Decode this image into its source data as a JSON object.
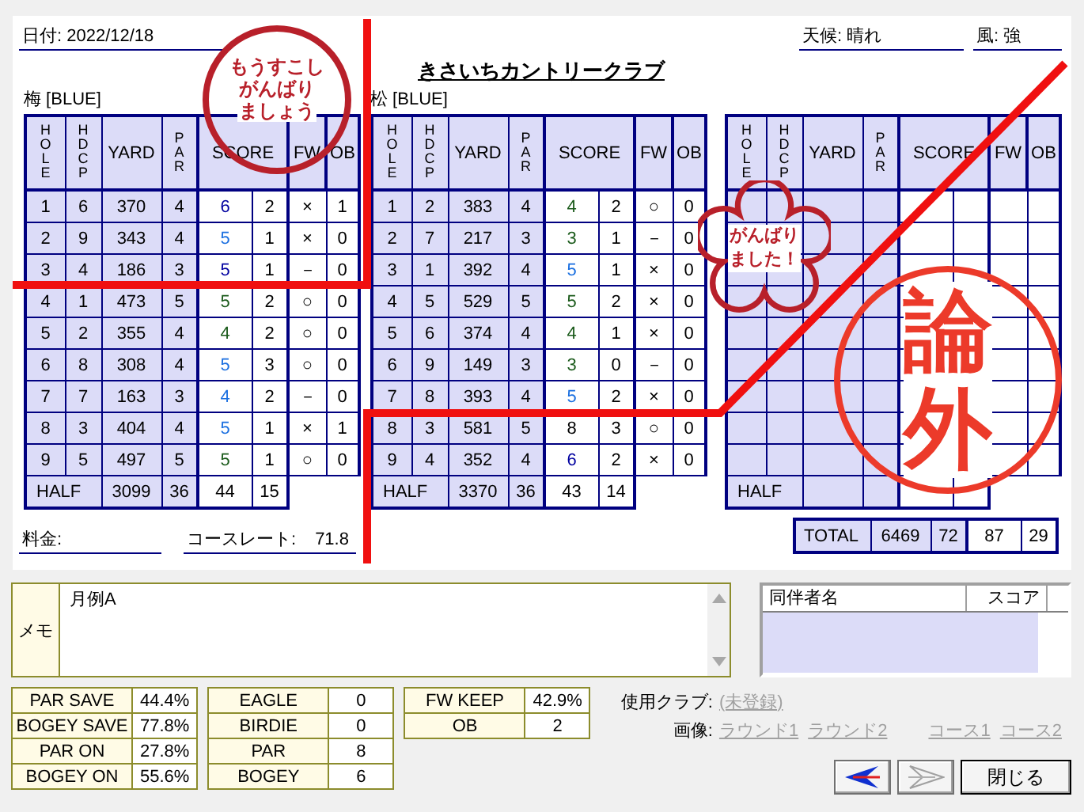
{
  "header": {
    "date_label": "日付:",
    "date": "2022/12/18",
    "course": "きさいちカントリークラブ",
    "weather_label": "天候:",
    "weather": "晴れ",
    "wind_label": "風:",
    "wind": "強"
  },
  "scorecards": [
    {
      "name": "梅 [BLUE]",
      "columns": [
        "HOLE",
        "HDCP",
        "YARD",
        "PAR",
        "SCORE",
        "FW",
        "OB"
      ],
      "rows": [
        {
          "hole": "1",
          "hdcp": "6",
          "yard": "370",
          "par": "4",
          "score": "6",
          "putts": "2",
          "fw": "×",
          "ob": "1",
          "kind": "double"
        },
        {
          "hole": "2",
          "hdcp": "9",
          "yard": "343",
          "par": "4",
          "score": "5",
          "putts": "1",
          "fw": "×",
          "ob": "0",
          "kind": "bogey"
        },
        {
          "hole": "3",
          "hdcp": "4",
          "yard": "186",
          "par": "3",
          "score": "5",
          "putts": "1",
          "fw": "－",
          "ob": "0",
          "kind": "double"
        },
        {
          "hole": "4",
          "hdcp": "1",
          "yard": "473",
          "par": "5",
          "score": "5",
          "putts": "2",
          "fw": "○",
          "ob": "0",
          "kind": "par"
        },
        {
          "hole": "5",
          "hdcp": "2",
          "yard": "355",
          "par": "4",
          "score": "4",
          "putts": "2",
          "fw": "○",
          "ob": "0",
          "kind": "par"
        },
        {
          "hole": "6",
          "hdcp": "8",
          "yard": "308",
          "par": "4",
          "score": "5",
          "putts": "3",
          "fw": "○",
          "ob": "0",
          "kind": "bogey"
        },
        {
          "hole": "7",
          "hdcp": "7",
          "yard": "163",
          "par": "3",
          "score": "4",
          "putts": "2",
          "fw": "－",
          "ob": "0",
          "kind": "bogey"
        },
        {
          "hole": "8",
          "hdcp": "3",
          "yard": "404",
          "par": "4",
          "score": "5",
          "putts": "1",
          "fw": "×",
          "ob": "1",
          "kind": "bogey"
        },
        {
          "hole": "9",
          "hdcp": "5",
          "yard": "497",
          "par": "5",
          "score": "5",
          "putts": "1",
          "fw": "○",
          "ob": "0",
          "kind": "par"
        }
      ],
      "half": {
        "label": "HALF",
        "yard": "3099",
        "par": "36",
        "score": "44",
        "putts": "15"
      }
    },
    {
      "name": "松 [BLUE]",
      "columns": [
        "HOLE",
        "HDCP",
        "YARD",
        "PAR",
        "SCORE",
        "FW",
        "OB"
      ],
      "rows": [
        {
          "hole": "1",
          "hdcp": "2",
          "yard": "383",
          "par": "4",
          "score": "4",
          "putts": "2",
          "fw": "○",
          "ob": "0",
          "kind": "par"
        },
        {
          "hole": "2",
          "hdcp": "7",
          "yard": "217",
          "par": "3",
          "score": "3",
          "putts": "1",
          "fw": "－",
          "ob": "0",
          "kind": "par"
        },
        {
          "hole": "3",
          "hdcp": "1",
          "yard": "392",
          "par": "4",
          "score": "5",
          "putts": "1",
          "fw": "×",
          "ob": "0",
          "kind": "bogey"
        },
        {
          "hole": "4",
          "hdcp": "5",
          "yard": "529",
          "par": "5",
          "score": "5",
          "putts": "2",
          "fw": "×",
          "ob": "0",
          "kind": "par"
        },
        {
          "hole": "5",
          "hdcp": "6",
          "yard": "374",
          "par": "4",
          "score": "4",
          "putts": "1",
          "fw": "×",
          "ob": "0",
          "kind": "par"
        },
        {
          "hole": "6",
          "hdcp": "9",
          "yard": "149",
          "par": "3",
          "score": "3",
          "putts": "0",
          "fw": "－",
          "ob": "0",
          "kind": "par"
        },
        {
          "hole": "7",
          "hdcp": "8",
          "yard": "393",
          "par": "4",
          "score": "5",
          "putts": "2",
          "fw": "×",
          "ob": "0",
          "kind": "bogey"
        },
        {
          "hole": "8",
          "hdcp": "3",
          "yard": "581",
          "par": "5",
          "score": "8",
          "putts": "3",
          "fw": "○",
          "ob": "0",
          "kind": "triple"
        },
        {
          "hole": "9",
          "hdcp": "4",
          "yard": "352",
          "par": "4",
          "score": "6",
          "putts": "2",
          "fw": "×",
          "ob": "0",
          "kind": "double"
        }
      ],
      "half": {
        "label": "HALF",
        "yard": "3370",
        "par": "36",
        "score": "43",
        "putts": "14"
      }
    },
    {
      "columns": [
        "HOLE",
        "HDCP",
        "YARD",
        "PAR",
        "SCORE",
        "FW",
        "OB"
      ],
      "half": {
        "label": "HALF"
      }
    }
  ],
  "footer": {
    "fee_label": "料金:",
    "rating_label": "コースレート:",
    "rating": "71.8"
  },
  "total": {
    "label": "TOTAL",
    "yard": "6469",
    "par": "72",
    "score": "87",
    "putts": "29"
  },
  "stamps": [
    {
      "kind": "circle",
      "lines": [
        "もうすこし",
        "がんばり",
        "ましょう"
      ]
    },
    {
      "kind": "flower",
      "lines": [
        "がんばり",
        "ました！"
      ]
    },
    {
      "kind": "seal",
      "lines": [
        "論外"
      ]
    }
  ],
  "memo": {
    "label": "メモ",
    "text": "月例A"
  },
  "companions": {
    "columns": [
      "同伴者名",
      "スコア"
    ]
  },
  "stats": [
    [
      {
        "label": "PAR SAVE",
        "value": "44.4%"
      },
      {
        "label": "BOGEY SAVE",
        "value": "77.8%"
      },
      {
        "label": "PAR ON",
        "value": "27.8%"
      },
      {
        "label": "BOGEY ON",
        "value": "55.6%"
      }
    ],
    [
      {
        "label": "EAGLE",
        "value": "0"
      },
      {
        "label": "BIRDIE",
        "value": "0"
      },
      {
        "label": "PAR",
        "value": "8"
      },
      {
        "label": "BOGEY",
        "value": "6"
      }
    ],
    [
      {
        "label": "FW KEEP",
        "value": "42.9%"
      },
      {
        "label": "OB",
        "value": "2"
      }
    ]
  ],
  "club": {
    "label": "使用クラブ:",
    "value": "(未登録)"
  },
  "images": {
    "label": "画像:",
    "links": [
      "ラウンド1",
      "ラウンド2",
      "コース1",
      "コース2"
    ]
  },
  "buttons": {
    "prev_disabled": false,
    "next_disabled": true,
    "close": "閉じる"
  }
}
